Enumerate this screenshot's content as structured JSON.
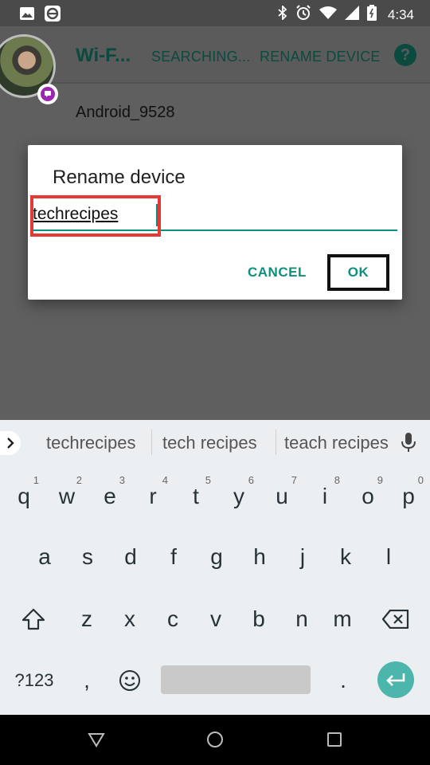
{
  "status_bar": {
    "time": "4:34",
    "left_icons": [
      "image-icon",
      "e-app-icon"
    ],
    "right_icons": [
      "bluetooth-icon",
      "alarm-icon",
      "wifi-icon",
      "signal-icon",
      "battery-icon"
    ]
  },
  "app_bar": {
    "title": "Wi-F...",
    "actions": [
      "SEARCHING...",
      "RENAME DEVICE"
    ],
    "help_label": "?"
  },
  "device": {
    "name": "Android_9528"
  },
  "dialog": {
    "title": "Rename device",
    "input_value": "techrecipes",
    "cancel_label": "CANCEL",
    "ok_label": "OK"
  },
  "keyboard": {
    "suggestions": [
      "techrecipes",
      "tech recipes",
      "teach recipes"
    ],
    "row1": [
      {
        "key": "q",
        "hint": "1"
      },
      {
        "key": "w",
        "hint": "2"
      },
      {
        "key": "e",
        "hint": "3"
      },
      {
        "key": "r",
        "hint": "4"
      },
      {
        "key": "t",
        "hint": "5"
      },
      {
        "key": "y",
        "hint": "6"
      },
      {
        "key": "u",
        "hint": "7"
      },
      {
        "key": "i",
        "hint": "8"
      },
      {
        "key": "o",
        "hint": "9"
      },
      {
        "key": "p",
        "hint": "0"
      }
    ],
    "row2": [
      "a",
      "s",
      "d",
      "f",
      "g",
      "h",
      "j",
      "k",
      "l"
    ],
    "row3": [
      "z",
      "x",
      "c",
      "v",
      "b",
      "n",
      "m"
    ],
    "symbols_label": "?123",
    "comma_label": ",",
    "period_label": "."
  },
  "colors": {
    "accent": "#0d8f7e",
    "app_text": "#0b4a3f",
    "highlight_red": "#e53935",
    "enter_key": "#4db6ac"
  }
}
